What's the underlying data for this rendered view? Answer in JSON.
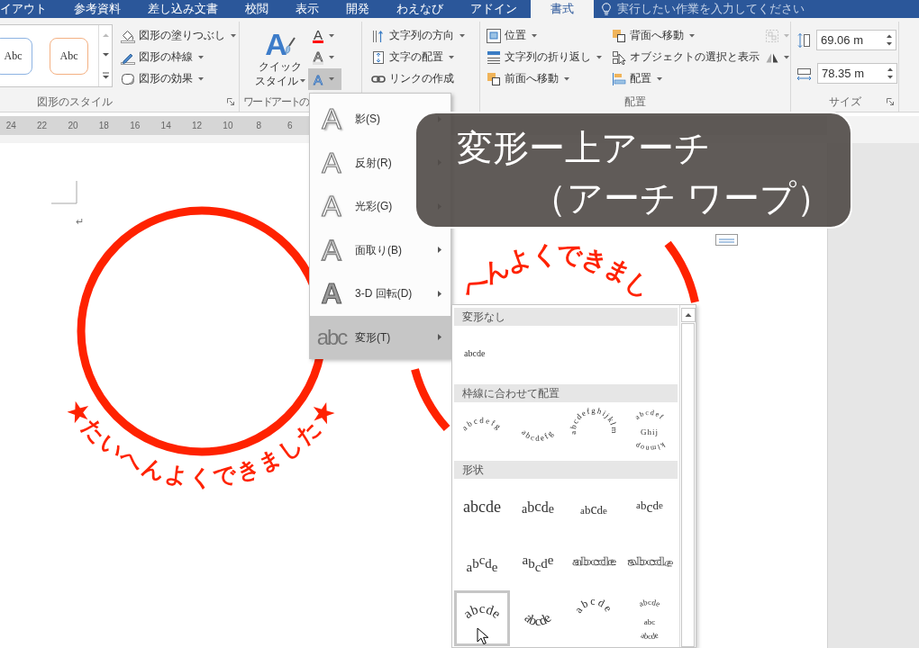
{
  "ribbon_tabs": [
    {
      "label": "イアウト",
      "selected": false
    },
    {
      "label": "参考資料",
      "selected": false
    },
    {
      "label": "差し込み文書",
      "selected": false
    },
    {
      "label": "校閲",
      "selected": false
    },
    {
      "label": "表示",
      "selected": false
    },
    {
      "label": "開発",
      "selected": false
    },
    {
      "label": "わえなび",
      "selected": false
    },
    {
      "label": "アドイン",
      "selected": false
    },
    {
      "label": "書式",
      "selected": true
    }
  ],
  "tell_me": {
    "placeholder": "実行したい作業を入力してください"
  },
  "shape_styles": {
    "label": "図形のスタイル",
    "launcher": true,
    "samples": [
      {
        "text": "Abc",
        "color": "#8db3e2"
      },
      {
        "text": "Abc",
        "color": "#f4b183"
      }
    ],
    "commands": [
      {
        "label": "図形の塗りつぶし",
        "dropdown": true
      },
      {
        "label": "図形の枠線",
        "dropdown": true
      },
      {
        "label": "図形の効果",
        "dropdown": true
      }
    ]
  },
  "wordart_styles": {
    "label": "ワードアートの",
    "quick_styles": {
      "glyph": "A",
      "lines": [
        "クイック",
        "スタイル"
      ],
      "dropdown": true
    },
    "text_buttons": [
      {
        "kind": "fill",
        "glyph": "A",
        "pressed": false,
        "dropdown": true
      },
      {
        "kind": "outline",
        "glyph": "A",
        "pressed": false,
        "dropdown": true
      },
      {
        "kind": "effects",
        "glyph": "A",
        "pressed": true,
        "dropdown": true
      }
    ]
  },
  "text_group": {
    "commands": [
      {
        "label": "文字列の方向",
        "dropdown": true
      },
      {
        "label": "文字の配置",
        "dropdown": true
      },
      {
        "label": "リンクの作成",
        "dropdown": false
      }
    ]
  },
  "arrange": {
    "label": "配置",
    "columns": [
      [
        {
          "label": "位置",
          "dropdown": true
        },
        {
          "label": "文字列の折り返し",
          "dropdown": true
        },
        {
          "label": "前面へ移動",
          "dropdown": true
        }
      ],
      [
        {
          "label": "背面へ移動",
          "dropdown": true
        },
        {
          "label": "オブジェクトの選択と表示",
          "dropdown": false
        },
        {
          "label": "配置",
          "dropdown": true
        }
      ]
    ],
    "icon_buttons": [
      {
        "disabled": true,
        "dropdown": true
      },
      {
        "disabled": false,
        "dropdown": true
      }
    ]
  },
  "size": {
    "label": "サイズ",
    "launcher": true,
    "fields": [
      {
        "value": "69.06 m"
      },
      {
        "value": "78.35 m"
      }
    ]
  },
  "ruler": {
    "numbers": [
      "24",
      "22",
      "20",
      "18",
      "16",
      "14",
      "12",
      "10",
      "8",
      "6"
    ]
  },
  "document": {
    "paragraph_mark": "↵",
    "stamps": [
      {
        "kind": "ring",
        "text": "★たいへんよくできました★"
      },
      {
        "kind": "arch",
        "text": "へんよくできまし"
      }
    ]
  },
  "wordart_menu": {
    "items": [
      {
        "kind": "shadow",
        "glyph": "A",
        "label": "影(S)",
        "submenu": true,
        "selected": false
      },
      {
        "kind": "reflection",
        "glyph": "A",
        "label": "反射(R)",
        "submenu": true,
        "selected": false
      },
      {
        "kind": "glow",
        "glyph": "A",
        "label": "光彩(G)",
        "submenu": true,
        "selected": false
      },
      {
        "kind": "bevel",
        "glyph": "A",
        "label": "面取り(B)",
        "submenu": true,
        "selected": false
      },
      {
        "kind": "rotation",
        "glyph": "A",
        "label": "3-D 回転(D)",
        "submenu": true,
        "selected": false
      },
      {
        "kind": "transform",
        "glyph": "abc",
        "label": "変形(T)",
        "submenu": true,
        "selected": true
      }
    ]
  },
  "transform_gallery": {
    "sections": [
      {
        "title": "変形なし",
        "items": [
          {
            "kind": "none",
            "sample": "abcde",
            "selected": false
          }
        ]
      },
      {
        "title": "枠線に合わせて配置",
        "items": [
          {
            "kind": "path-arch-up",
            "sample": "abcdefg",
            "selected": false
          },
          {
            "kind": "path-arch-down",
            "sample": "abcdefg",
            "selected": false
          },
          {
            "kind": "path-circle",
            "sample": "abcdefghijklm",
            "selected": false
          },
          {
            "kind": "path-button",
            "sample_lines": [
              "abcdef",
              "Ghij",
              "klmnop"
            ],
            "selected": false
          }
        ]
      },
      {
        "title": "形状",
        "items": [
          {
            "kind": "square",
            "sample": "abcde",
            "selected": false
          },
          {
            "kind": "stop",
            "sample": "abcde",
            "selected": false
          },
          {
            "kind": "triangle-up",
            "sample": "abcde",
            "selected": false
          },
          {
            "kind": "triangle-down",
            "sample": "abcde",
            "selected": false
          },
          {
            "kind": "chevron-up",
            "sample": "abcde",
            "selected": false
          },
          {
            "kind": "chevron-down",
            "sample": "abcde",
            "selected": false
          },
          {
            "kind": "ring-inside",
            "sample": "abcde",
            "selected": false
          },
          {
            "kind": "ring-outside",
            "sample": "abcde",
            "selected": false
          },
          {
            "kind": "arch-up",
            "sample": "abcde",
            "selected": true
          },
          {
            "kind": "arch-down",
            "sample": "abcde",
            "selected": false
          },
          {
            "kind": "circle",
            "sample": "abcde",
            "selected": false
          },
          {
            "kind": "button",
            "sample_lines": [
              "abcde",
              "abc",
              "abcde"
            ],
            "selected": false
          }
        ]
      }
    ]
  },
  "caption": {
    "lines": [
      "変形ー上アーチ",
      "（アーチ ワープ）"
    ]
  }
}
